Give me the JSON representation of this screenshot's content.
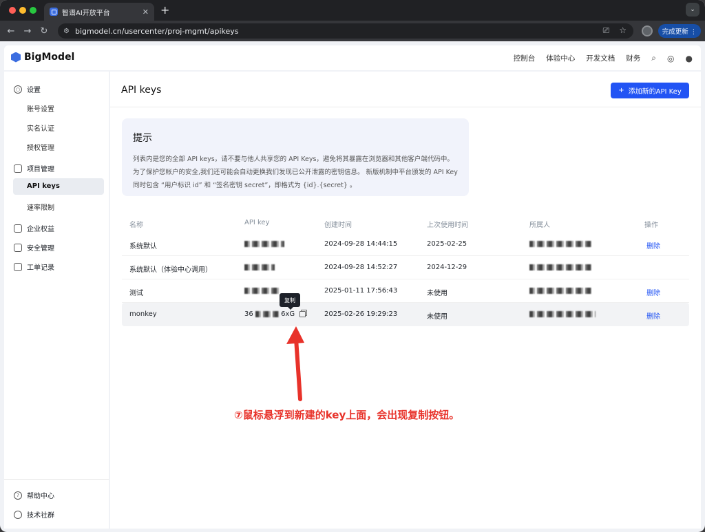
{
  "browser": {
    "tab_title": "智谱AI开放平台",
    "tab_close": "✕",
    "new_tab": "+",
    "url": "bigmodel.cn/usercenter/proj-mgmt/apikeys",
    "update_button": "完成更新 ⋮",
    "menu": "⌄"
  },
  "header": {
    "logo_text": "BigModel",
    "nav": [
      "控制台",
      "体验中心",
      "开发文档",
      "财务"
    ]
  },
  "sidebar": {
    "groups": [
      {
        "label": "设置",
        "icon": "settings-icon"
      },
      {
        "label": "项目管理",
        "icon": "folder-icon"
      },
      {
        "label": "企业权益",
        "icon": "building-icon"
      },
      {
        "label": "安全管理",
        "icon": "lock-icon"
      },
      {
        "label": "工单记录",
        "icon": "ticket-icon"
      }
    ],
    "items": [
      "账号设置",
      "实名认证",
      "授权管理",
      "API keys",
      "速率限制"
    ],
    "footer": [
      {
        "label": "帮助中心",
        "icon": "help-icon"
      },
      {
        "label": "技术社群",
        "icon": "community-icon"
      }
    ]
  },
  "main": {
    "title": "API keys",
    "add_button": "添加新的API Key",
    "hint": {
      "title": "提示",
      "body": "列表内是您的全部 API keys，请不要与他人共享您的 API Keys，避免将其暴露在浏览器和其他客户端代码中。为了保护您帐户的安全,我们还可能会自动更换我们发现已公开泄露的密钥信息。 新版机制中平台颁发的 API Key 同时包含 “用户标识 id” 和 “签名密钥 secret”，即格式为 {id}.{secret} 。"
    },
    "table": {
      "headers": [
        "名称",
        "API key",
        "创建时间",
        "上次使用时间",
        "所属人",
        "操作"
      ],
      "rows": [
        {
          "name": "系统默认",
          "key_prefix": "",
          "key_suffix": "",
          "created": "2024-09-28 14:44:15",
          "last_used": "2025-02-25",
          "action": "删除"
        },
        {
          "name": "系统默认（体验中心调用）",
          "key_prefix": "",
          "key_suffix": "",
          "created": "2024-09-28 14:52:27",
          "last_used": "2024-12-29",
          "action": ""
        },
        {
          "name": "测试",
          "key_prefix": "",
          "key_suffix": "",
          "created": "2025-01-11 17:56:43",
          "last_used": "未使用",
          "action": "删除"
        },
        {
          "name": "monkey",
          "key_prefix": "36",
          "key_suffix": "6xG",
          "created": "2025-02-26 19:29:23",
          "last_used": "未使用",
          "action": "删除"
        }
      ]
    },
    "tooltip": "复制"
  },
  "annotation": {
    "text": "⑦鼠标悬浮到新建的key上面，会出现复制按钮。",
    "color": "#e8322a"
  },
  "colors": {
    "primary": "#2254f4",
    "accent_red": "#e8322a"
  }
}
